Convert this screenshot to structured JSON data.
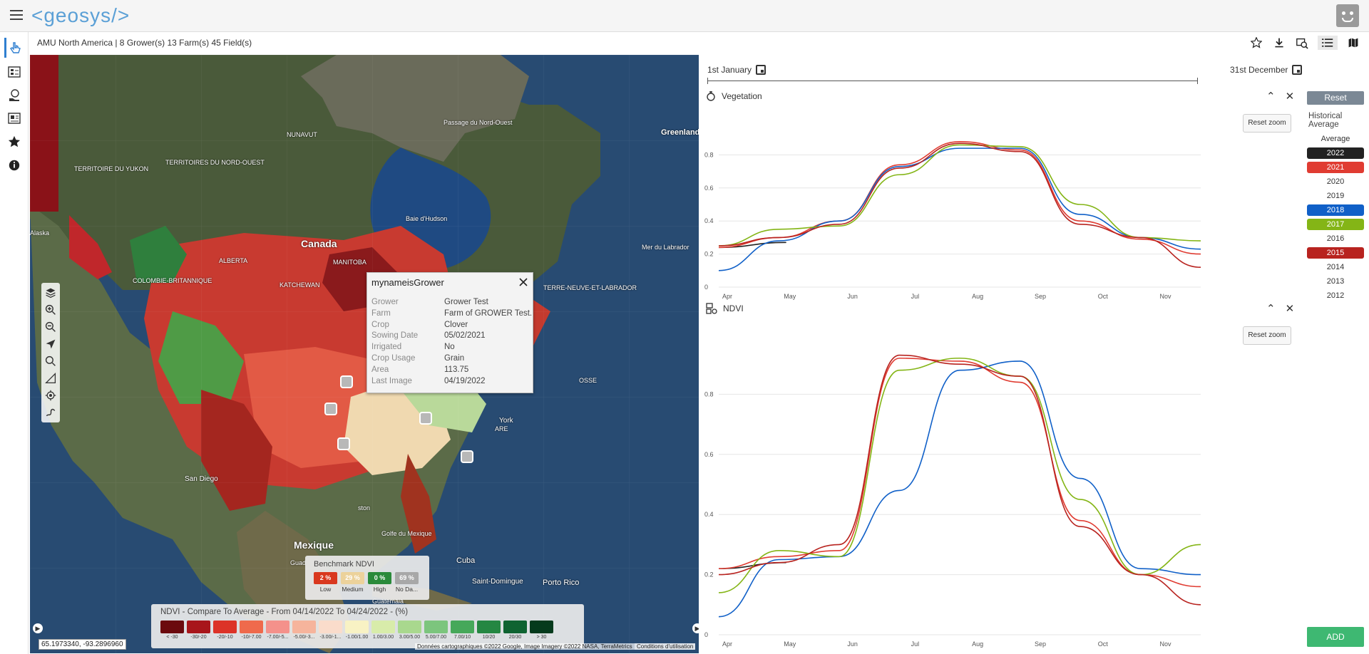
{
  "app": {
    "logo": "<geosys/>"
  },
  "info_bar": {
    "text": "AMU North America |  8 Grower(s)  13 Farm(s)  45 Field(s)"
  },
  "sidebar": {
    "items": [
      {
        "icon": "pointer-icon"
      },
      {
        "icon": "field-list-icon"
      },
      {
        "icon": "globe-hand-icon"
      },
      {
        "icon": "report-icon"
      },
      {
        "icon": "star-icon"
      },
      {
        "icon": "info-icon"
      }
    ]
  },
  "toolbar": {
    "icons": [
      "star-icon",
      "download-icon",
      "compare-icon",
      "list-view-icon",
      "map-view-icon"
    ]
  },
  "map": {
    "labels": [
      {
        "text": "TERRITOIRE DU YUKON"
      },
      {
        "text": "TERRITOIRES DU NORD-OUEST"
      },
      {
        "text": "NUNAVUT"
      },
      {
        "text": "Passage du Nord-Ouest"
      },
      {
        "text": "Baie d'Hudson"
      },
      {
        "text": "Canada"
      },
      {
        "text": "ALBERTA"
      },
      {
        "text": "MANITOBA"
      },
      {
        "text": "COLOMBIE-BRITANNIQUE"
      },
      {
        "text": "KATCHEWAN"
      },
      {
        "text": "Alaska"
      },
      {
        "text": "Greenland"
      },
      {
        "text": "Mer du Labrador"
      },
      {
        "text": "TERRE-NEUVE-ET-LABRADOR"
      },
      {
        "text": "San Diego"
      },
      {
        "text": "Mexique"
      },
      {
        "text": "Golfe du Mexique"
      },
      {
        "text": "Cuba"
      },
      {
        "text": "Saint-Domingue"
      },
      {
        "text": "Porto Rico"
      },
      {
        "text": "York"
      },
      {
        "text": "ARE"
      },
      {
        "text": "OSSE"
      },
      {
        "text": "ston"
      },
      {
        "text": "Guad"
      },
      {
        "text": "Guatemala"
      }
    ],
    "coords": "65.1973340, -93.2896960",
    "attribution": "Données cartographiques ©2022 Google, Image Imagery ©2022 NASA, TerraMetrics",
    "terms": "Conditions d'utilisation"
  },
  "popup": {
    "title": "mynameisGrower",
    "rows": [
      {
        "key": "Grower",
        "value": "Grower Test"
      },
      {
        "key": "Farm",
        "value": "Farm of GROWER Test."
      },
      {
        "key": "Crop",
        "value": "Clover"
      },
      {
        "key": "Sowing Date",
        "value": "05/02/2021"
      },
      {
        "key": "Irrigated",
        "value": "No"
      },
      {
        "key": "Crop Usage",
        "value": "Grain"
      },
      {
        "key": "Area",
        "value": "113.75"
      },
      {
        "key": "Last Image",
        "value": "04/19/2022"
      }
    ]
  },
  "benchmark": {
    "title": "Benchmark NDVI",
    "cells": [
      {
        "pct": "2 %",
        "label": "Low",
        "color": "#d9381e"
      },
      {
        "pct": "29 %",
        "label": "Medium",
        "color": "#ecd29b"
      },
      {
        "pct": "0 %",
        "label": "High",
        "color": "#2a8a3a"
      },
      {
        "pct": "69 %",
        "label": "No Da...",
        "color": "#a8a8a8"
      }
    ]
  },
  "ndvi_legend": {
    "title": "NDVI - Compare To Average - From 04/14/2022 To 04/24/2022 - (%)",
    "cells": [
      {
        "label": "< -30",
        "color": "#6b0a0e"
      },
      {
        "label": "-30/-20",
        "color": "#a8161b"
      },
      {
        "label": "-20/-10",
        "color": "#dc3328"
      },
      {
        "label": "-10/-7.00",
        "color": "#ef6a4c"
      },
      {
        "label": "-7.00/-5...",
        "color": "#f4918b"
      },
      {
        "label": "-5.00/-3...",
        "color": "#f6b49c"
      },
      {
        "label": "-3.00/-1...",
        "color": "#fadccb"
      },
      {
        "label": "-1.00/1.00",
        "color": "#f8f2c4"
      },
      {
        "label": "1.00/3.00",
        "color": "#d8ecaa"
      },
      {
        "label": "3.00/5.00",
        "color": "#a9d88e"
      },
      {
        "label": "5.00/7.00",
        "color": "#7cc57d"
      },
      {
        "label": "7.00/10",
        "color": "#46a85a"
      },
      {
        "label": "10/20",
        "color": "#258742"
      },
      {
        "label": "20/30",
        "color": "#0f6331"
      },
      {
        "label": "> 30",
        "color": "#053a1c"
      }
    ]
  },
  "dates": {
    "start": "1st January",
    "end": "31st December"
  },
  "panels": [
    {
      "title": "Vegetation",
      "icon": "vegetation-icon",
      "reset_zoom": "Reset zoom"
    },
    {
      "title": "NDVI",
      "icon": "ndvi-icon",
      "reset_zoom": "Reset zoom"
    }
  ],
  "legend": {
    "reset": "Reset",
    "historical": "Historical Average",
    "average": "Average",
    "years": [
      {
        "year": "2022",
        "color": "#222222",
        "selected": true
      },
      {
        "year": "2021",
        "color": "#e03c32",
        "selected": true
      },
      {
        "year": "2020",
        "color": "",
        "selected": false
      },
      {
        "year": "2019",
        "color": "",
        "selected": false
      },
      {
        "year": "2018",
        "color": "#1060c8",
        "selected": true
      },
      {
        "year": "2017",
        "color": "#84b516",
        "selected": true
      },
      {
        "year": "2016",
        "color": "",
        "selected": false
      },
      {
        "year": "2015",
        "color": "#b8231f",
        "selected": true
      },
      {
        "year": "2014",
        "color": "",
        "selected": false
      },
      {
        "year": "2013",
        "color": "",
        "selected": false
      },
      {
        "year": "2012",
        "color": "",
        "selected": false
      }
    ],
    "add": "ADD"
  },
  "chart_data": [
    {
      "type": "line",
      "title": "Vegetation",
      "categories": [
        "Apr",
        "May",
        "Jun",
        "Jul",
        "Aug",
        "Sep",
        "Oct",
        "Nov"
      ],
      "ylim": [
        0,
        1
      ],
      "yticks": [
        "0",
        "0.2",
        "0.4",
        "0.6",
        "0.8"
      ],
      "series": [
        {
          "name": "2022",
          "color": "#222222",
          "values": [
            0.24,
            0.27
          ]
        },
        {
          "name": "2021",
          "color": "#e03c32",
          "values": [
            0.24,
            0.3,
            0.4,
            0.74,
            0.88,
            0.83,
            0.4,
            0.29,
            0.2
          ]
        },
        {
          "name": "2018",
          "color": "#1060c8",
          "values": [
            0.1,
            0.28,
            0.4,
            0.73,
            0.84,
            0.84,
            0.44,
            0.3,
            0.23
          ]
        },
        {
          "name": "2017",
          "color": "#84b516",
          "values": [
            0.25,
            0.35,
            0.37,
            0.68,
            0.86,
            0.85,
            0.5,
            0.3,
            0.28
          ]
        },
        {
          "name": "2015",
          "color": "#b8231f",
          "values": [
            0.25,
            0.3,
            0.38,
            0.72,
            0.87,
            0.82,
            0.38,
            0.3,
            0.12
          ]
        }
      ]
    },
    {
      "type": "line",
      "title": "NDVI",
      "categories": [
        "Apr",
        "May",
        "Jun",
        "Jul",
        "Aug",
        "Sep",
        "Oct",
        "Nov"
      ],
      "ylim": [
        0,
        1
      ],
      "yticks": [
        "0",
        "0.2",
        "0.4",
        "0.6",
        "0.8"
      ],
      "series": [
        {
          "name": "2022",
          "color": "#222222",
          "values": [
            0.22,
            0.24
          ]
        },
        {
          "name": "2021",
          "color": "#e03c32",
          "values": [
            0.22,
            0.26,
            0.28,
            0.92,
            0.91,
            0.84,
            0.38,
            0.2,
            0.16
          ]
        },
        {
          "name": "2018",
          "color": "#1060c8",
          "values": [
            0.06,
            0.25,
            0.26,
            0.48,
            0.88,
            0.91,
            0.52,
            0.22,
            0.2
          ]
        },
        {
          "name": "2017",
          "color": "#84b516",
          "values": [
            0.14,
            0.28,
            0.26,
            0.88,
            0.92,
            0.86,
            0.45,
            0.2,
            0.3
          ]
        },
        {
          "name": "2015",
          "color": "#b8231f",
          "values": [
            0.2,
            0.24,
            0.3,
            0.93,
            0.9,
            0.86,
            0.36,
            0.2,
            0.1
          ]
        }
      ]
    }
  ]
}
